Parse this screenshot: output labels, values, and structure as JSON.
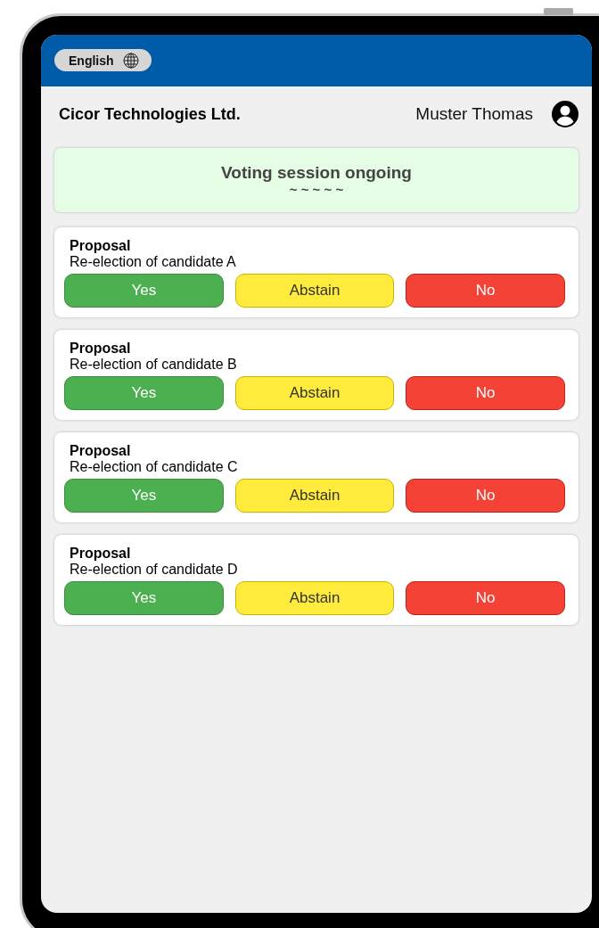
{
  "header": {
    "language": "English"
  },
  "title_bar": {
    "company": "Cicor Technologies Ltd.",
    "user": "Muster Thomas"
  },
  "session_banner": {
    "title": "Voting session ongoing",
    "subtitle": "~ ~ ~ ~ ~"
  },
  "proposals": [
    {
      "title": "Proposal",
      "description": "Re-election of candidate A",
      "options": [
        {
          "label": "Yes",
          "kind": "yes"
        },
        {
          "label": "Abstain",
          "kind": "abstain"
        },
        {
          "label": "No",
          "kind": "no"
        }
      ]
    },
    {
      "title": "Proposal",
      "description": "Re-election of candidate B",
      "options": [
        {
          "label": "Yes",
          "kind": "yes"
        },
        {
          "label": "Abstain",
          "kind": "abstain"
        },
        {
          "label": "No",
          "kind": "no"
        }
      ]
    },
    {
      "title": "Proposal",
      "description": "Re-election of candidate C",
      "options": [
        {
          "label": "Yes",
          "kind": "yes"
        },
        {
          "label": "Abstain",
          "kind": "abstain"
        },
        {
          "label": "No",
          "kind": "no"
        }
      ]
    },
    {
      "title": "Proposal",
      "description": "Re-election of candidate D",
      "options": [
        {
          "label": "Yes",
          "kind": "yes"
        },
        {
          "label": "Abstain",
          "kind": "abstain"
        },
        {
          "label": "No",
          "kind": "no"
        }
      ]
    }
  ]
}
